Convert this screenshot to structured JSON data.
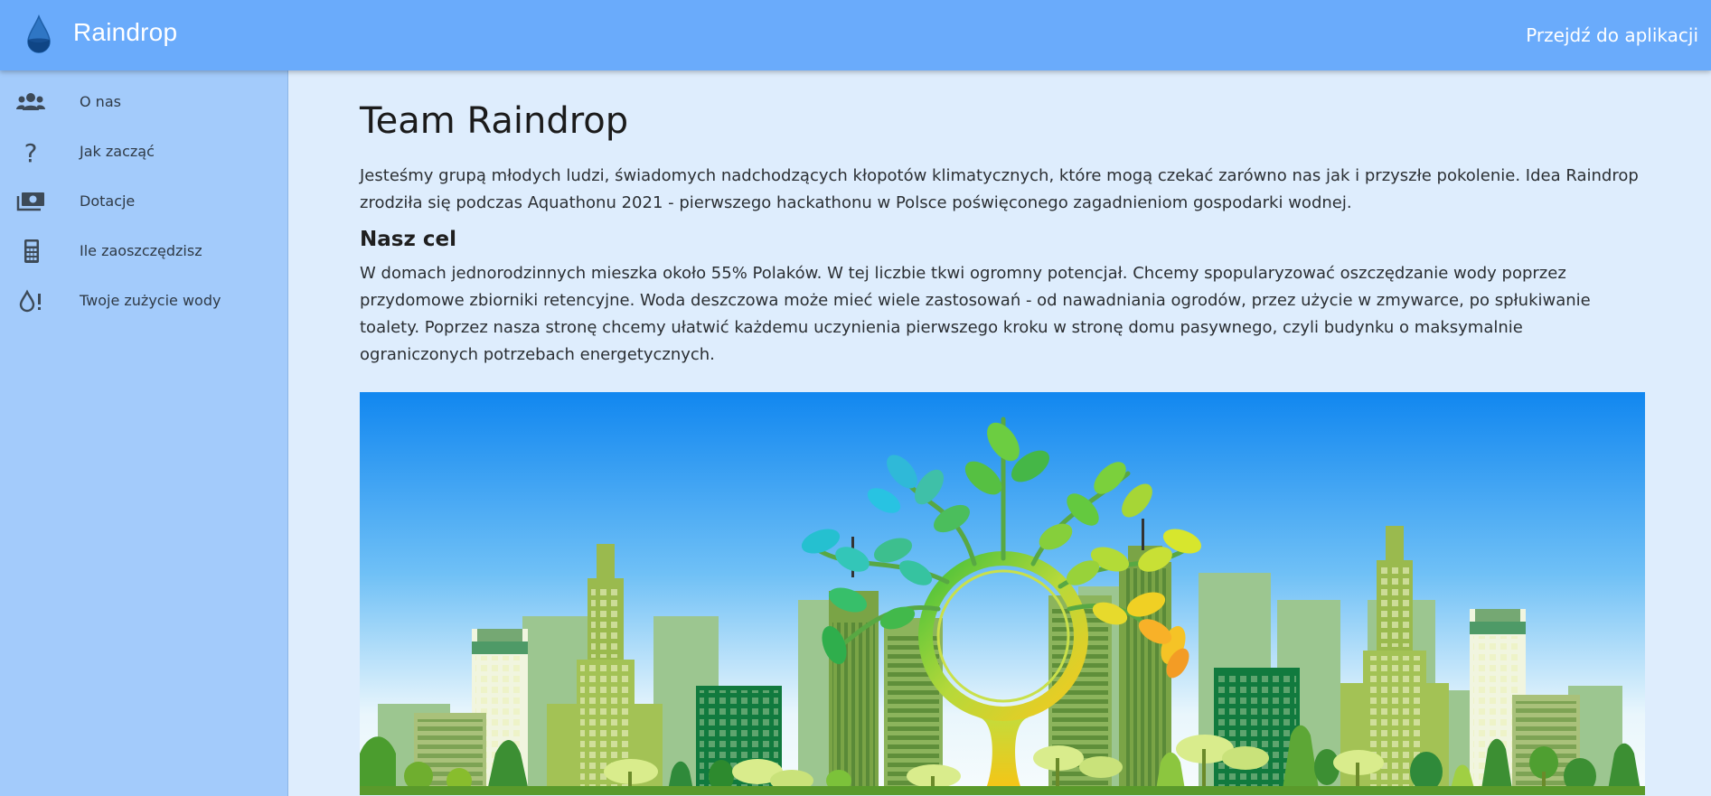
{
  "header": {
    "brand": "Raindrop",
    "brand_icon": "raindrop-icon",
    "app_link": "Przejdź do aplikacji"
  },
  "sidebar": {
    "items": [
      {
        "label": "O nas",
        "icon": "users-icon"
      },
      {
        "label": "Jak zacząć",
        "icon": "question-icon"
      },
      {
        "label": "Dotacje",
        "icon": "money-icon"
      },
      {
        "label": "Ile zaoszczędzisz",
        "icon": "calculator-icon"
      },
      {
        "label": "Twoje zużycie wody",
        "icon": "water-alert-icon"
      }
    ]
  },
  "main": {
    "title": "Team Raindrop",
    "intro": "Jesteśmy grupą młodych ludzi, świadomych nadchodzących kłopotów klimatycznych, które mogą czekać zarówno nas jak i przyszłe pokolenie. Idea Raindrop zrodziła się podczas Aquathonu 2021 - pierwszego hackathonu w Polsce poświęconego zagadnieniom gospodarki wodnej.",
    "goal_heading": "Nasz cel",
    "goal_text": "W domach jednorodzinnych mieszka około 55% Polaków. W tej liczbie tkwi ogromny potencjał. Chcemy spopularyzować oszczędzanie wody poprzez przydomowe zbiorniki retencyjne. Woda deszczowa może mieć wiele zastosowań - od nawadniania ogrodów, przez użycie w zmywarce, po spłukiwanie toalety. Poprzez nasza stronę chcemy ułatwić każdemu uczynienia pierwszego kroku w stronę domu pasywnego, czyli budynku o maksymalnie ograniczonych potrzebach energetycznych."
  },
  "colors": {
    "header": "#6aabfb",
    "sidebar": "#a3cbfb",
    "background": "#deedfd"
  }
}
